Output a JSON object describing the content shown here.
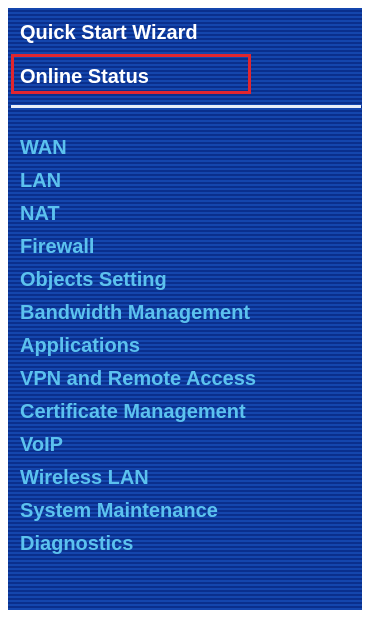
{
  "top_links": {
    "quick_start": "Quick Start Wizard",
    "online_status": "Online Status"
  },
  "menu": {
    "items": [
      {
        "label": "WAN"
      },
      {
        "label": "LAN"
      },
      {
        "label": "NAT"
      },
      {
        "label": "Firewall"
      },
      {
        "label": "Objects Setting"
      },
      {
        "label": "Bandwidth Management"
      },
      {
        "label": "Applications"
      },
      {
        "label": "VPN and Remote Access"
      },
      {
        "label": "Certificate Management"
      },
      {
        "label": "VoIP"
      },
      {
        "label": "Wireless LAN"
      },
      {
        "label": "System Maintenance"
      },
      {
        "label": "Diagnostics"
      }
    ]
  },
  "colors": {
    "background": "#0d3a9c",
    "top_link_text": "#ffffff",
    "menu_text": "#5cc2ee",
    "highlight_border": "#e0262f",
    "divider": "#e9eef8"
  }
}
